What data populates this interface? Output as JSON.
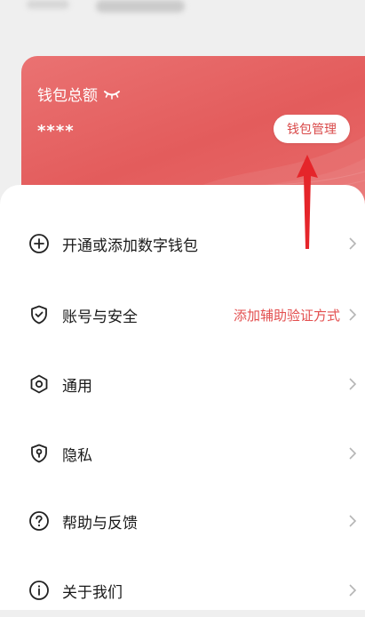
{
  "wallet": {
    "title": "钱包总额",
    "amount": "****",
    "manage_label": "钱包管理"
  },
  "menu": {
    "items": [
      {
        "label": "开通或添加数字钱包",
        "icon": "plus-circle-icon",
        "hint": ""
      },
      {
        "label": "账号与安全",
        "icon": "shield-check-icon",
        "hint": "添加辅助验证方式"
      },
      {
        "label": "通用",
        "icon": "hexagon-settings-icon",
        "hint": ""
      },
      {
        "label": "隐私",
        "icon": "privacy-keyhole-icon",
        "hint": ""
      },
      {
        "label": "帮助与反馈",
        "icon": "question-circle-icon",
        "hint": ""
      },
      {
        "label": "关于我们",
        "icon": "info-circle-icon",
        "hint": ""
      }
    ]
  },
  "colors": {
    "brand_red": "#e35c5c",
    "hint_red": "#e34f4f",
    "annotation_arrow": "#e5252a"
  }
}
